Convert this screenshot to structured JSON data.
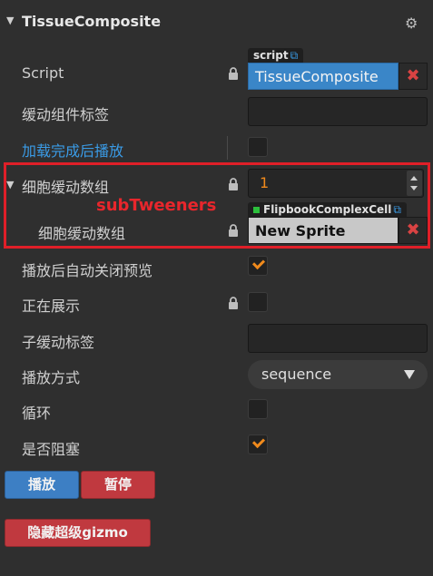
{
  "header": {
    "title": "TissueComposite",
    "arrow": "▼",
    "gear": "⚙"
  },
  "script": {
    "label": "Script",
    "type_tag": "script",
    "value": "TissueComposite",
    "clear": "✖"
  },
  "tween_tag": {
    "label": "缓动组件标签",
    "value": ""
  },
  "play_on_load": {
    "label": "加载完成后播放",
    "checked": false
  },
  "cell_tweeners": {
    "arrow": "▼",
    "label": "细胞缓动数组",
    "count": "1",
    "annotation": "subTweeners",
    "item": {
      "label": "细胞缓动数组",
      "type_tag": "FlipbookComplexCell",
      "value": "New Sprite",
      "clear": "✖"
    }
  },
  "auto_close_preview": {
    "label": "播放后自动关闭预览",
    "checked": true
  },
  "showing": {
    "label": "正在展示",
    "checked": false
  },
  "sub_tween_tag": {
    "label": "子缓动标签",
    "value": ""
  },
  "play_mode": {
    "label": "播放方式",
    "value": "sequence"
  },
  "loop": {
    "label": "循环",
    "checked": false
  },
  "blocking": {
    "label": "是否阻塞",
    "checked": true
  },
  "buttons": {
    "play": "播放",
    "pause": "暂停",
    "hide_gizmo": "隐藏超级gizmo"
  },
  "colors": {
    "accent": "#f08a1c",
    "link": "#3a9be6",
    "highlight": "#e01f28",
    "script_bg": "#3a86c8"
  }
}
